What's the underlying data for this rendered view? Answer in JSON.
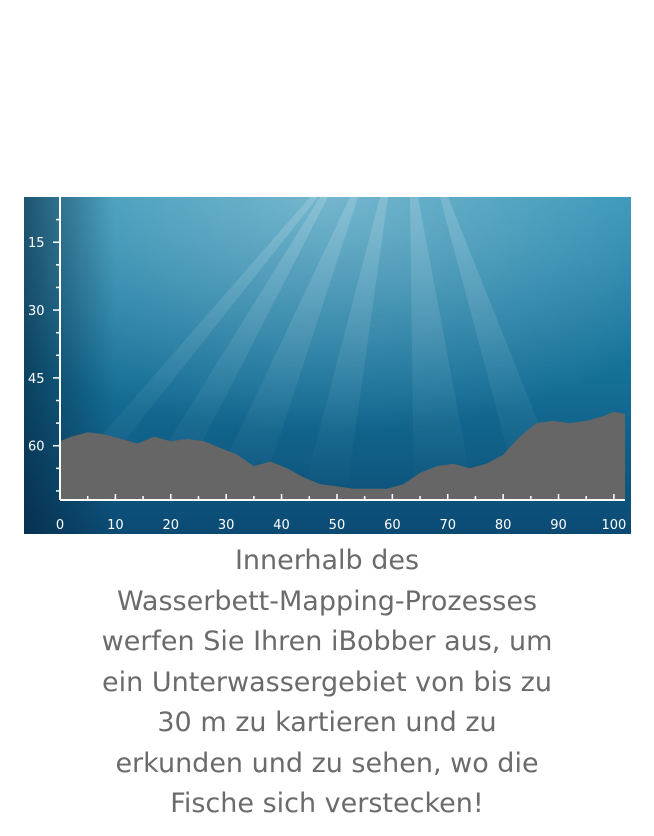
{
  "chart_data": {
    "type": "area",
    "title": "",
    "xlabel": "",
    "ylabel": "",
    "xlim": [
      0,
      102
    ],
    "ylim": [
      5,
      72
    ],
    "y_inverted": true,
    "x_ticks": [
      0,
      10,
      20,
      30,
      40,
      50,
      60,
      70,
      80,
      90,
      100
    ],
    "y_ticks": [
      15,
      30,
      45,
      60
    ],
    "grid": false,
    "colors": {
      "water_top": "#2a8fb3",
      "water_mid": "#146f97",
      "water_bottom": "#0b4a73",
      "bottom_fill": "#666666",
      "axis": "#ffffff"
    },
    "series": [
      {
        "x": [
          0,
          2,
          5,
          8,
          11,
          14,
          17,
          20,
          23,
          26,
          29,
          32,
          35,
          38,
          41,
          44,
          47,
          50,
          53,
          56,
          59,
          62,
          65,
          68,
          71,
          74,
          77,
          80,
          83,
          86,
          89,
          92,
          95,
          98,
          100,
          102
        ],
        "values": [
          59,
          58,
          57,
          57.5,
          58.5,
          59.5,
          58,
          59,
          58.5,
          59,
          60.5,
          62,
          64.5,
          63.5,
          65,
          67,
          68.5,
          69,
          69.5,
          69.5,
          69.5,
          68.5,
          66,
          64.5,
          64,
          65,
          64,
          62,
          58,
          55,
          54.5,
          55,
          54.5,
          53.5,
          52.5,
          53
        ]
      }
    ]
  },
  "caption": {
    "lines": [
      "Innerhalb des",
      "Wasserbett-Mapping-Prozesses",
      "werfen Sie Ihren iBobber aus, um",
      "ein Unterwassergebiet von bis zu",
      "30 m zu kartieren und zu",
      "erkunden und zu sehen, wo die",
      "Fische sich verstecken!"
    ]
  }
}
